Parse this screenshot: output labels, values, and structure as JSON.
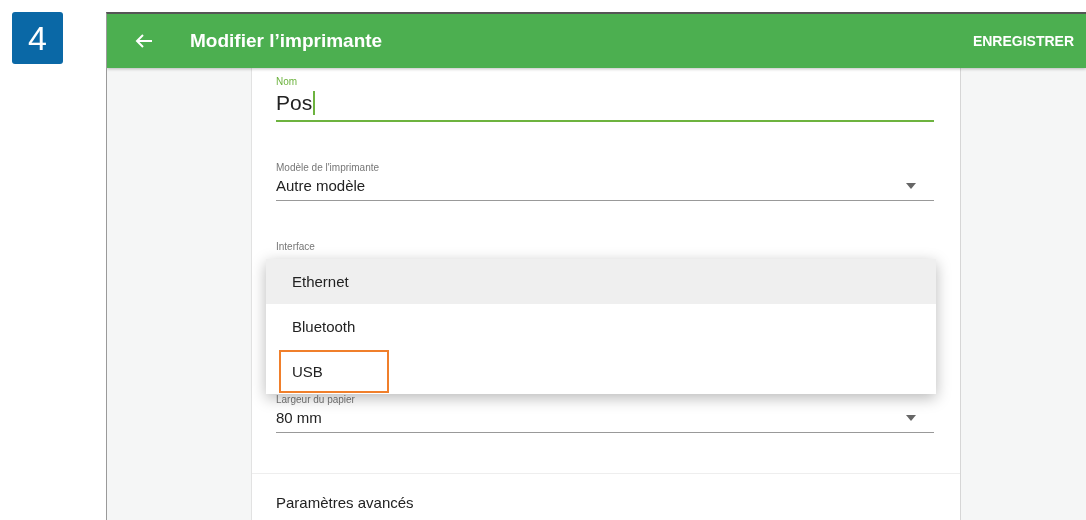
{
  "step": "4",
  "app_bar": {
    "title": "Modifier l’imprimante",
    "action": "ENREGISTRER"
  },
  "fields": [
    {
      "kind": "text",
      "label": "Nom",
      "value": "Pos",
      "focused": true
    },
    {
      "kind": "select",
      "label": "Modèle de l'imprimante",
      "value": "Autre modèle",
      "focused": false
    },
    {
      "kind": "menu",
      "label": "Interface",
      "options": [
        {
          "label": "Ethernet",
          "selected": true,
          "annotated": false
        },
        {
          "label": "Bluetooth",
          "selected": false,
          "annotated": false
        },
        {
          "label": "USB",
          "selected": false,
          "annotated": true
        }
      ]
    },
    {
      "kind": "select",
      "label": "Largeur du papier",
      "value": "80 mm",
      "focused": false
    }
  ],
  "section": "Paramètres avancés"
}
